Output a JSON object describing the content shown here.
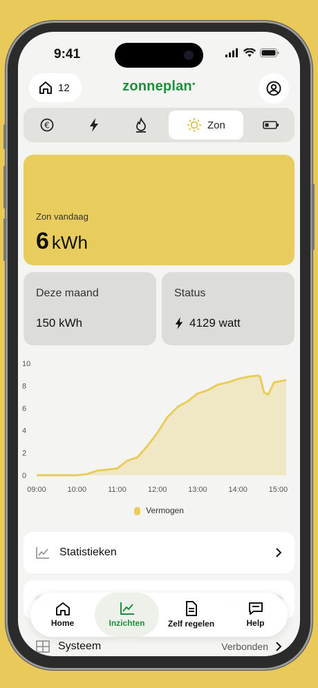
{
  "status_bar": {
    "time": "9:41"
  },
  "header": {
    "home_count": "12",
    "logo": "zonneplan",
    "profile_icon": "user-circle-icon"
  },
  "tabs": [
    {
      "icon": "euro-icon"
    },
    {
      "icon": "lightning-icon"
    },
    {
      "icon": "flame-icon"
    },
    {
      "icon": "sun-icon",
      "label": "Zon",
      "active": true
    },
    {
      "icon": "battery-icon"
    }
  ],
  "sun_card": {
    "label": "Zon vandaag",
    "value": "6",
    "unit": "kWh",
    "color": "#e8cd5e"
  },
  "month_card": {
    "label": "Deze maand",
    "value": "150 kWh"
  },
  "status_card": {
    "label": "Status",
    "value": "4129 watt"
  },
  "chart_data": {
    "type": "area",
    "x_ticks": [
      "09:00",
      "10:00",
      "11:00",
      "12:00",
      "13:00",
      "14:00",
      "15:00"
    ],
    "y_ticks": [
      "0",
      "2",
      "4",
      "6",
      "8",
      "10"
    ],
    "ylim": [
      0,
      10
    ],
    "xlim": [
      9,
      15.2
    ],
    "series": [
      {
        "name": "Vermogen",
        "color": "#e8cd5e",
        "x": [
          9.0,
          9.5,
          10.0,
          10.25,
          10.5,
          10.75,
          11.0,
          11.25,
          11.5,
          11.75,
          12.0,
          12.25,
          12.5,
          12.75,
          13.0,
          13.25,
          13.5,
          13.75,
          14.0,
          14.25,
          14.5,
          14.55,
          14.65,
          14.75,
          14.9,
          15.2
        ],
        "y": [
          0,
          0,
          0,
          0.1,
          0.4,
          0.5,
          0.6,
          1.3,
          1.6,
          2.6,
          3.8,
          5.2,
          6.1,
          6.6,
          7.3,
          7.6,
          8.1,
          8.3,
          8.6,
          8.8,
          8.9,
          8.8,
          7.4,
          7.2,
          8.3,
          8.5
        ]
      }
    ],
    "legend": "Vermogen",
    "grid": false
  },
  "list": {
    "statistieken": "Statistieken",
    "systeem": "Systeem",
    "systeem_status": "Verbonden"
  },
  "bottom_nav": [
    {
      "label": "Home",
      "icon": "home-icon"
    },
    {
      "label": "Inzichten",
      "icon": "chart-icon",
      "active": true
    },
    {
      "label": "Zelf regelen",
      "icon": "document-icon"
    },
    {
      "label": "Help",
      "icon": "chat-icon"
    }
  ]
}
